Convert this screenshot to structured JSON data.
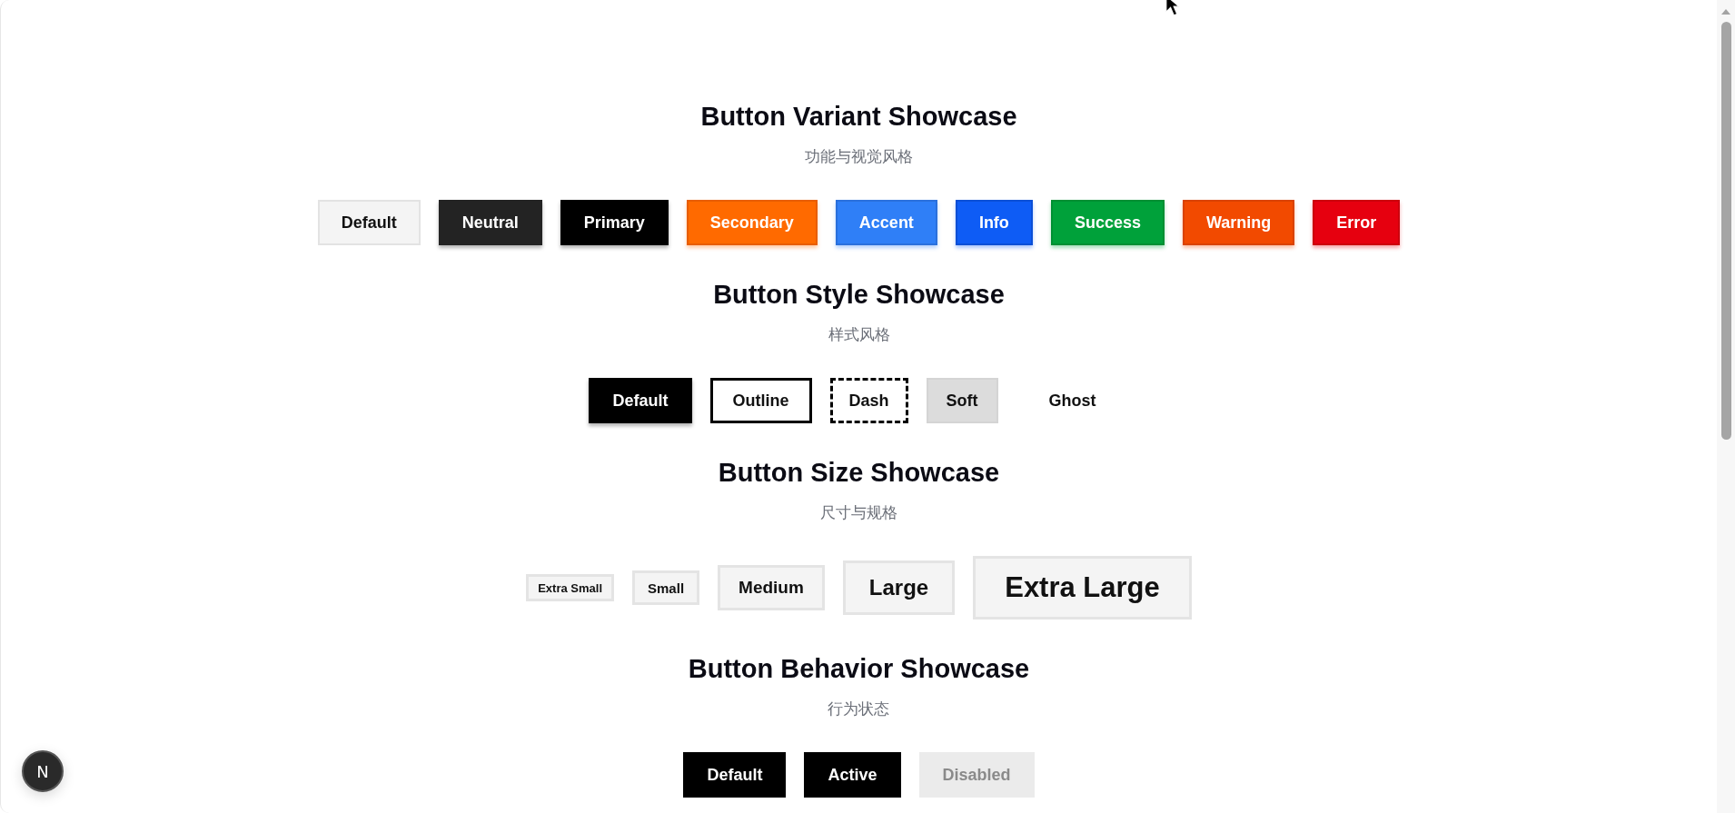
{
  "sections": [
    {
      "kind": "variant",
      "title": "Button Variant Showcase",
      "subtitle": "功能与视觉风格",
      "buttons": [
        {
          "label": "Default",
          "kind": "default"
        },
        {
          "label": "Neutral",
          "kind": "neutral"
        },
        {
          "label": "Primary",
          "kind": "primary"
        },
        {
          "label": "Secondary",
          "kind": "secondary"
        },
        {
          "label": "Accent",
          "kind": "accent"
        },
        {
          "label": "Info",
          "kind": "info"
        },
        {
          "label": "Success",
          "kind": "success"
        },
        {
          "label": "Warning",
          "kind": "warning"
        },
        {
          "label": "Error",
          "kind": "error"
        }
      ]
    },
    {
      "kind": "style",
      "title": "Button Style Showcase",
      "subtitle": "样式风格",
      "buttons": [
        {
          "label": "Default",
          "kind": "default"
        },
        {
          "label": "Outline",
          "kind": "outline"
        },
        {
          "label": "Dash",
          "kind": "dash"
        },
        {
          "label": "Soft",
          "kind": "soft"
        },
        {
          "label": "Ghost",
          "kind": "ghost"
        }
      ]
    },
    {
      "kind": "size",
      "title": "Button Size Showcase",
      "subtitle": "尺寸与规格",
      "buttons": [
        {
          "label": "Extra Small",
          "kind": "xs"
        },
        {
          "label": "Small",
          "kind": "sm"
        },
        {
          "label": "Medium",
          "kind": "md"
        },
        {
          "label": "Large",
          "kind": "lg"
        },
        {
          "label": "Extra Large",
          "kind": "xl"
        }
      ]
    },
    {
      "kind": "behavior",
      "title": "Button Behavior Showcase",
      "subtitle": "行为状态",
      "buttons": [
        {
          "label": "Default",
          "kind": "default",
          "disabled": false
        },
        {
          "label": "Active",
          "kind": "active",
          "disabled": false
        },
        {
          "label": "Disabled",
          "kind": "default",
          "disabled": true
        }
      ]
    }
  ],
  "dev_badge": {
    "label": "N"
  }
}
